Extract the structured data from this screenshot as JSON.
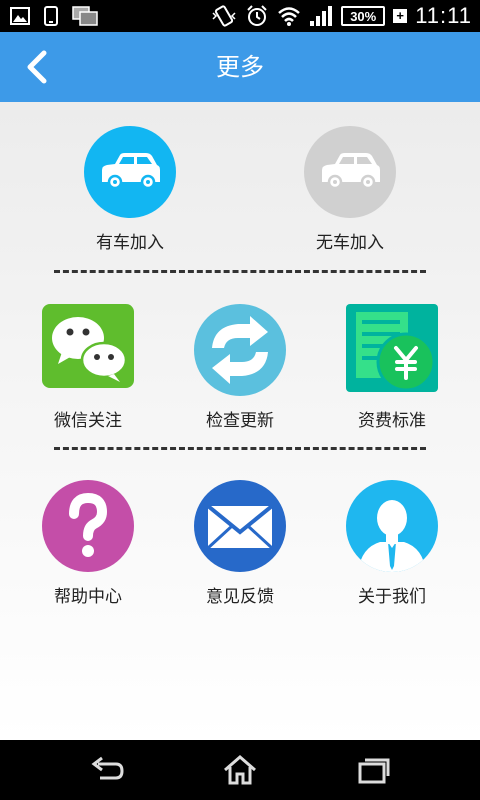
{
  "status_bar": {
    "time": "11:11",
    "battery": "30%",
    "battery_charging": "+"
  },
  "header": {
    "title": "更多",
    "back_icon": "chevron-left-icon",
    "color": "#3d9ae8"
  },
  "rows": [
    [
      {
        "label": "有车加入",
        "icon": "car-icon",
        "color": "#12b6f2"
      },
      {
        "label": "无车加入",
        "icon": "car-icon",
        "color": "#d0d0d0"
      }
    ],
    [
      {
        "label": "微信关注",
        "icon": "wechat-icon",
        "color": "#5fbd2d"
      },
      {
        "label": "检查更新",
        "icon": "refresh-icon",
        "color": "#5bc0de"
      },
      {
        "label": "资费标准",
        "icon": "tariff-icon",
        "color": "#00b39e"
      }
    ],
    [
      {
        "label": "帮助中心",
        "icon": "help-icon",
        "color": "#c44ea8"
      },
      {
        "label": "意见反馈",
        "icon": "mail-icon",
        "color": "#2769c9"
      },
      {
        "label": "关于我们",
        "icon": "person-icon",
        "color": "#1fb7ef"
      }
    ]
  ],
  "nav_bar": [
    "back-icon",
    "home-icon",
    "recent-apps-icon"
  ]
}
